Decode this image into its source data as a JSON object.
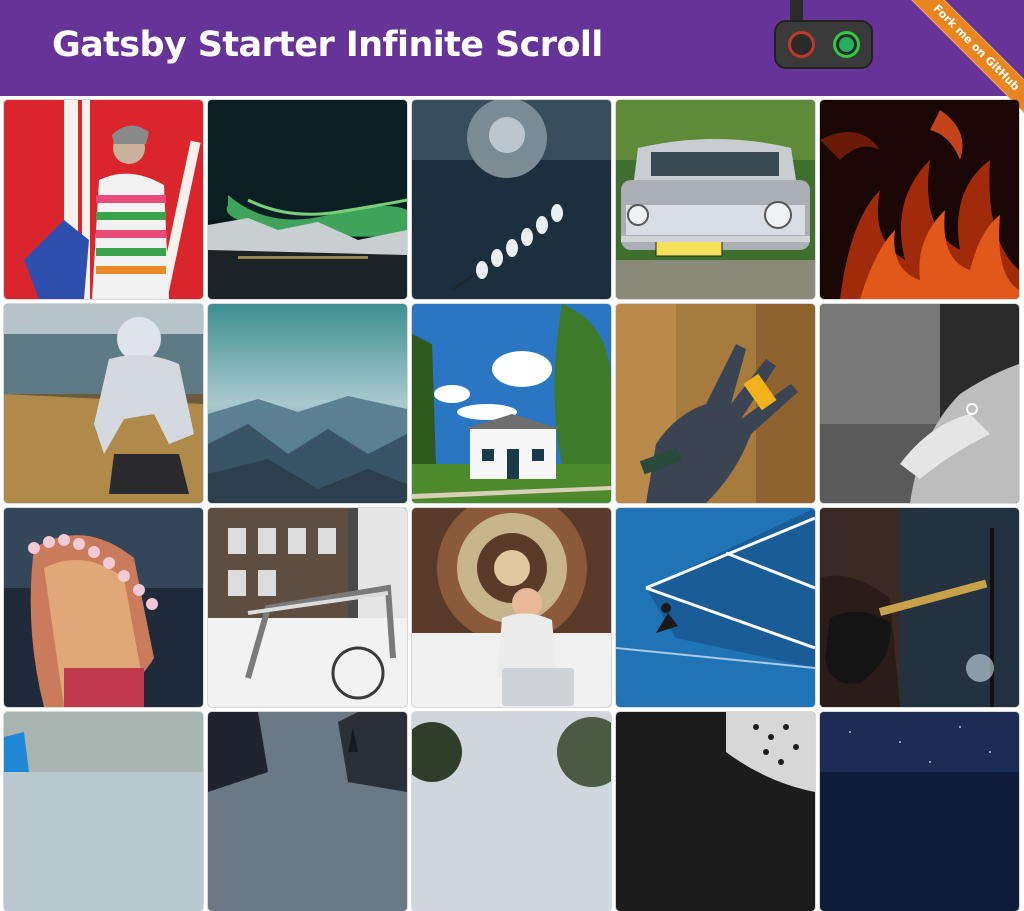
{
  "header": {
    "title": "Gatsby Starter Infinite Scroll",
    "background": "#663399"
  },
  "toggle": {
    "icon": "traffic-light-toggle-icon",
    "colors": {
      "red": "#c0392b",
      "green": "#2ecc40"
    }
  },
  "ribbon": {
    "label": "Fork me on GitHub",
    "color": "#e8851e"
  },
  "gallery": {
    "photos": [
      {
        "subject": "woman-striped-sweater-red-wall",
        "colors": [
          "#d9252b",
          "#f4f0ec"
        ]
      },
      {
        "subject": "aurora-borealis-night",
        "colors": [
          "#0b1a1c",
          "#3fa35a"
        ]
      },
      {
        "subject": "flower-stem-bokeh",
        "colors": [
          "#1b2f3c",
          "#cfd8dc"
        ]
      },
      {
        "subject": "vintage-car-plate",
        "colors": [
          "#3f6f2c",
          "#9aa0a6"
        ]
      },
      {
        "subject": "fire-flames",
        "colors": [
          "#1a0604",
          "#e0581a"
        ]
      },
      {
        "subject": "person-silver-jacket-lake",
        "colors": [
          "#6b5a3b",
          "#cfd4dc"
        ]
      },
      {
        "subject": "mountains-aerial-haze",
        "colors": [
          "#3d8f8f",
          "#2d4a5a"
        ]
      },
      {
        "subject": "white-house-blue-sky",
        "colors": [
          "#2a76c2",
          "#4d8a2d"
        ]
      },
      {
        "subject": "hand-with-tape",
        "colors": [
          "#a77a3e",
          "#3b4452"
        ]
      },
      {
        "subject": "holding-hands-bw",
        "colors": [
          "#2b2b2b",
          "#9a9a9a"
        ]
      },
      {
        "subject": "girl-flower-crown",
        "colors": [
          "#1f2b3a",
          "#c97b5b"
        ]
      },
      {
        "subject": "snowy-bike-rack",
        "colors": [
          "#4a4a4a",
          "#f2f2f2"
        ]
      },
      {
        "subject": "woman-bed-laptop-tapestry",
        "colors": [
          "#5a3b2a",
          "#f0f0f0"
        ]
      },
      {
        "subject": "tennis-court-beijing",
        "colors": [
          "#1f74b5",
          "#ffffff"
        ]
      },
      {
        "subject": "guitarist-stage",
        "colors": [
          "#243240",
          "#111111"
        ]
      },
      {
        "subject": "blurry-blue-partial",
        "colors": [
          "#5a7a8a",
          "#b9c8cf"
        ]
      },
      {
        "subject": "dark-building-partial",
        "colors": [
          "#1f2530",
          "#6b7886"
        ]
      },
      {
        "subject": "trees-partial",
        "colors": [
          "#cfd6dc",
          "#2e3e2a"
        ]
      },
      {
        "subject": "dark-dotted-partial",
        "colors": [
          "#1c1c1c",
          "#d7d7d7"
        ]
      },
      {
        "subject": "night-sky-partial",
        "colors": [
          "#0f1c3a",
          "#2a3a66"
        ]
      }
    ]
  }
}
